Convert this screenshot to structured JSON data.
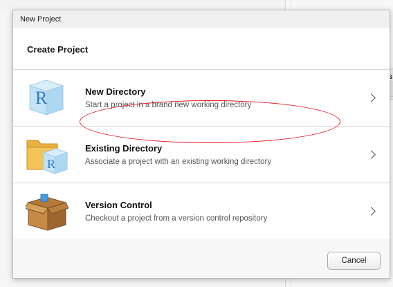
{
  "dialog": {
    "window_title": "New Project",
    "heading": "Create Project",
    "options": [
      {
        "title": "New Directory",
        "description": "Start a project in a brand new working directory",
        "icon": "r-cube-icon"
      },
      {
        "title": "Existing Directory",
        "description": "Associate a project with an existing working directory",
        "icon": "folder-r-icon"
      },
      {
        "title": "Version Control",
        "description": "Checkout a project from a version control repository",
        "icon": "box-icon"
      }
    ],
    "cancel_label": "Cancel"
  },
  "background": {
    "fragment_char": "s"
  },
  "colors": {
    "annotation": "#e0141b",
    "divider": "#d6d6d6"
  }
}
